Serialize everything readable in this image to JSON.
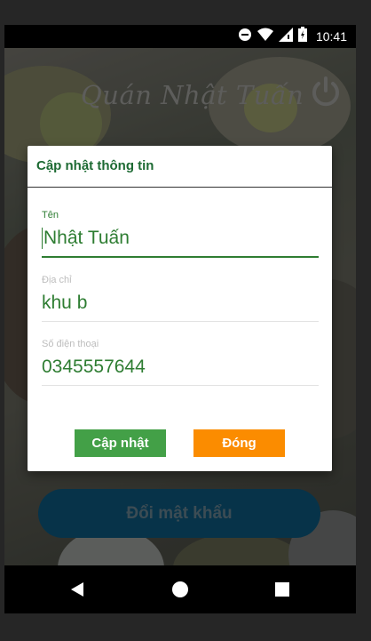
{
  "status_bar": {
    "time": "10:41",
    "icons": [
      "do-not-disturb-icon",
      "wifi-icon",
      "signal-icon",
      "battery-icon"
    ]
  },
  "app": {
    "title": "Quán Nhật Tuấn",
    "change_password_label": "Đổi mật khẩu"
  },
  "dialog": {
    "title": "Cập nhật thông tin",
    "fields": [
      {
        "label": "Tên",
        "value": "Nhật Tuấn"
      },
      {
        "label": "Địa chỉ",
        "value": "khu b"
      },
      {
        "label": "Số điện thoại",
        "value": "0345557644"
      }
    ],
    "update_label": "Cập nhật",
    "close_label": "Đóng"
  },
  "colors": {
    "primary_green": "#2e7d32",
    "update_button": "#43a047",
    "close_button": "#fb8c00",
    "change_password_button": "#0e5d86"
  }
}
